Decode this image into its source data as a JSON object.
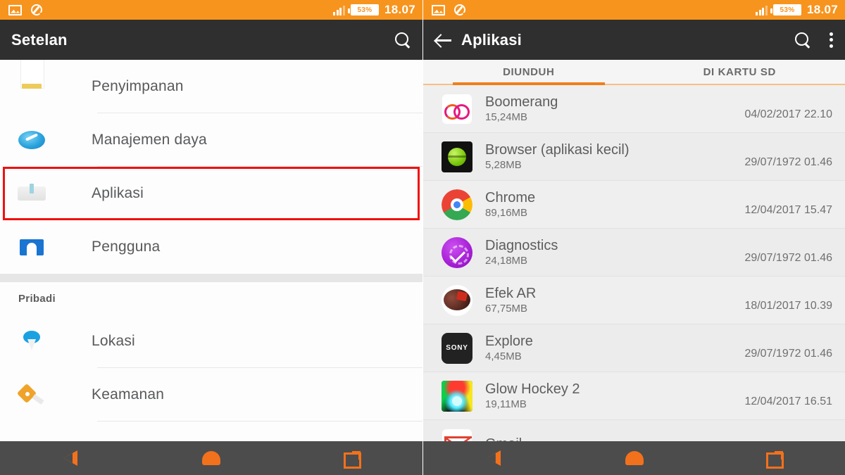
{
  "statusbar": {
    "icons": [
      "screenshot-icon",
      "sync-icon",
      "signal-icon"
    ],
    "battery_label": "53%",
    "time": "18.07",
    "bg_color": "#f7941e"
  },
  "left_screen": {
    "appbar": {
      "title": "Setelan",
      "search_icon": "search-icon",
      "bg_color": "#2f2f2f"
    },
    "items": [
      {
        "label": "Penyimpanan",
        "icon": "storage-icon",
        "partial_top": true
      },
      {
        "label": "Manajemen daya",
        "icon": "power-management-icon"
      },
      {
        "label": "Aplikasi",
        "icon": "apps-icon",
        "highlighted": true
      },
      {
        "label": "Pengguna",
        "icon": "user-icon"
      }
    ],
    "section_header": "Pribadi",
    "personal_items": [
      {
        "label": "Lokasi",
        "icon": "location-pin-icon"
      },
      {
        "label": "Keamanan",
        "icon": "security-key-icon"
      }
    ],
    "highlight_color": "#f01010"
  },
  "right_screen": {
    "appbar": {
      "back_icon": "back-arrow-icon",
      "title": "Aplikasi",
      "search_icon": "search-icon",
      "menu_icon": "overflow-menu-icon"
    },
    "tabs": [
      {
        "label": "DIUNDUH",
        "active": true
      },
      {
        "label": "DI KARTU SD",
        "active": false
      }
    ],
    "tab_accent": "#ef7f1a",
    "apps": [
      {
        "name": "Boomerang",
        "size": "15,24MB",
        "date": "04/02/2017 22.10",
        "icon": "boomerang-app-icon"
      },
      {
        "name": "Browser (aplikasi kecil)",
        "size": "5,28MB",
        "date": "29/07/1972 01.46",
        "icon": "browser-app-icon"
      },
      {
        "name": "Chrome",
        "size": "89,16MB",
        "date": "12/04/2017 15.47",
        "icon": "chrome-app-icon"
      },
      {
        "name": "Diagnostics",
        "size": "24,18MB",
        "date": "29/07/1972 01.46",
        "icon": "diagnostics-app-icon"
      },
      {
        "name": "Efek AR",
        "size": "67,75MB",
        "date": "18/01/2017 10.39",
        "icon": "ar-effect-app-icon"
      },
      {
        "name": "Explore",
        "size": "4,45MB",
        "date": "29/07/1972 01.46",
        "icon": "explore-sony-app-icon",
        "icon_text": "SONY"
      },
      {
        "name": "Glow Hockey 2",
        "size": "19,11MB",
        "date": "12/04/2017 16.51",
        "icon": "glow-hockey-app-icon"
      },
      {
        "name": "Gmail",
        "size": "",
        "date": "",
        "icon": "gmail-app-icon"
      }
    ]
  },
  "navbar": {
    "back": "nav-back-icon",
    "home": "nav-home-icon",
    "recents": "nav-recents-icon",
    "bg_color": "#4c4c4c",
    "accent": "#f2711c"
  }
}
